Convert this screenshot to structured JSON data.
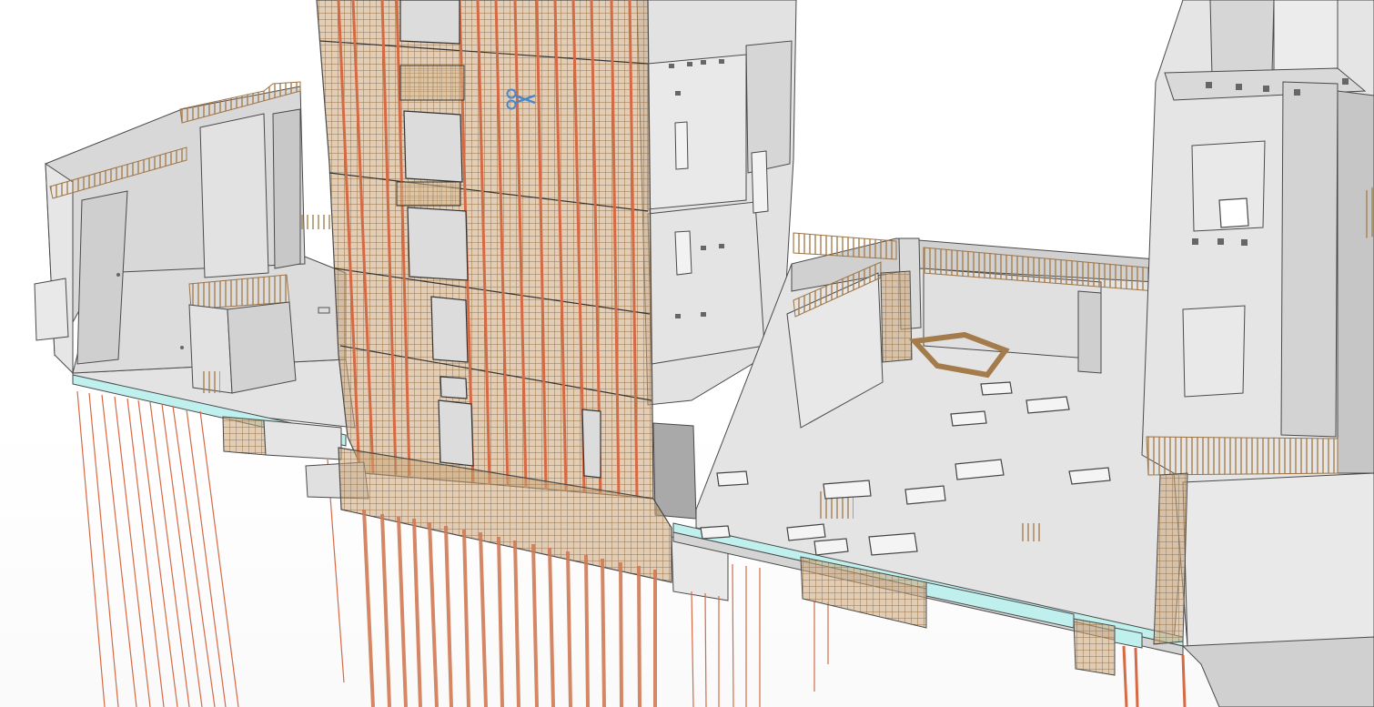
{
  "colors": {
    "concrete_light": "#e6e6e6",
    "concrete_mid": "#d9d9d9",
    "concrete_dark": "#c4c4c4",
    "edge": "#4a4a4a",
    "rebar_mesh": "#b8915c",
    "rebar_bar": "#d66a45",
    "insulation": "#bff0ee",
    "cursor_blue": "#4a86c8"
  },
  "icons": {
    "cursor": "scissors-icon"
  }
}
